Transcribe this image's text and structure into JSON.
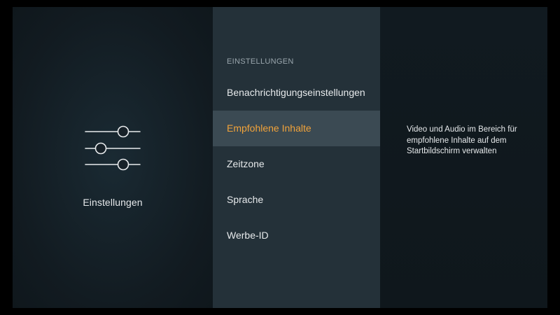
{
  "left": {
    "title": "Einstellungen",
    "icon": "settings-sliders-icon"
  },
  "menu": {
    "header": "EINSTELLUNGEN",
    "items": [
      {
        "label": "Benachrichtigungseinstellungen",
        "selected": false
      },
      {
        "label": "Empfohlene Inhalte",
        "selected": true
      },
      {
        "label": "Zeitzone",
        "selected": false
      },
      {
        "label": "Sprache",
        "selected": false
      },
      {
        "label": "Werbe-ID",
        "selected": false
      }
    ]
  },
  "description": {
    "text": "Video und Audio im Bereich für empfohlene Inhalte auf dem Startbildschirm verwalten"
  },
  "colors": {
    "accent": "#f2a33a",
    "menu_bg": "#243139",
    "selected_bg": "#3b4a53",
    "text": "#e7eaec"
  }
}
